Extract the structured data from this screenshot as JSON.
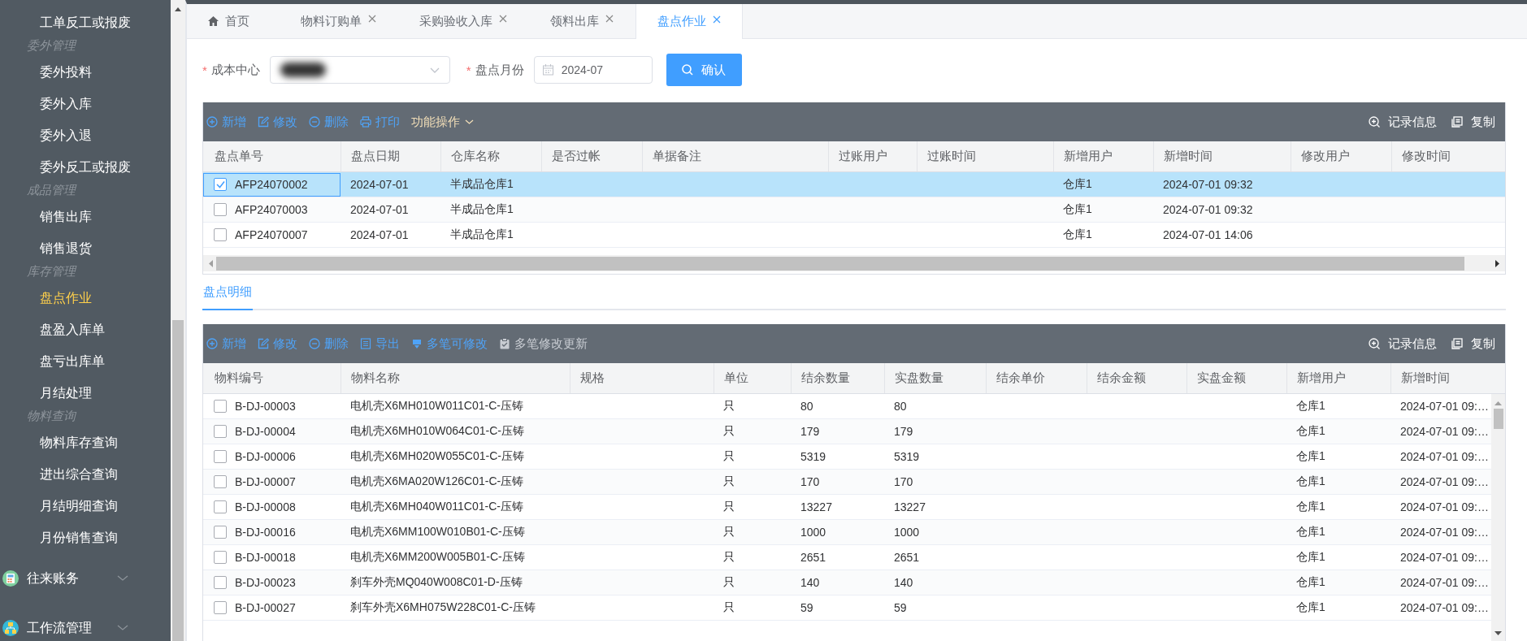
{
  "sidebar": {
    "items": [
      {
        "kind": "item",
        "label": "工单反工或报废",
        "selected": false
      },
      {
        "kind": "group",
        "label": "委外管理"
      },
      {
        "kind": "item",
        "label": "委外投料",
        "selected": false
      },
      {
        "kind": "item",
        "label": "委外入库",
        "selected": false
      },
      {
        "kind": "item",
        "label": "委外入退",
        "selected": false
      },
      {
        "kind": "item",
        "label": "委外反工或报废",
        "selected": false
      },
      {
        "kind": "group",
        "label": "成品管理"
      },
      {
        "kind": "item",
        "label": "销售出库",
        "selected": false
      },
      {
        "kind": "item",
        "label": "销售退货",
        "selected": false
      },
      {
        "kind": "group",
        "label": "库存管理"
      },
      {
        "kind": "item",
        "label": "盘点作业",
        "selected": true
      },
      {
        "kind": "item",
        "label": "盘盈入库单",
        "selected": false
      },
      {
        "kind": "item",
        "label": "盘亏出库单",
        "selected": false
      },
      {
        "kind": "item",
        "label": "月结处理",
        "selected": false
      },
      {
        "kind": "group",
        "label": "物料查询"
      },
      {
        "kind": "item",
        "label": "物料库存查询",
        "selected": false
      },
      {
        "kind": "item",
        "label": "进出综合查询",
        "selected": false
      },
      {
        "kind": "item",
        "label": "月结明细查询",
        "selected": false
      },
      {
        "kind": "item",
        "label": "月份销售查询",
        "selected": false
      },
      {
        "kind": "menu",
        "label": "往来账务"
      },
      {
        "kind": "menu",
        "label": "工作流管理"
      }
    ]
  },
  "tabs": [
    {
      "kind": "home",
      "label": "首页",
      "selected": false
    },
    {
      "kind": "page",
      "label": "物料订购单",
      "selected": false
    },
    {
      "kind": "page",
      "label": "采购验收入库",
      "selected": false
    },
    {
      "kind": "page",
      "label": "领料出库",
      "selected": false
    },
    {
      "kind": "page",
      "label": "盘点作业",
      "selected": true
    }
  ],
  "filter": {
    "fields": [
      {
        "kind": "select",
        "required_mark": "*",
        "label": "成本中心"
      },
      {
        "kind": "date",
        "required_mark": "*",
        "label": "盘点月份",
        "value": "2024-07"
      }
    ],
    "button": "确认"
  },
  "master_grid": {
    "actions": [
      {
        "kind": "add",
        "label": "新增",
        "disabled": false
      },
      {
        "kind": "edit",
        "label": "修改",
        "disabled": false
      },
      {
        "kind": "delete",
        "label": "删除",
        "disabled": false
      },
      {
        "kind": "print",
        "label": "打印",
        "disabled": false
      },
      {
        "kind": "menu",
        "label": "功能操作",
        "disabled": false
      }
    ],
    "right_actions": [
      {
        "kind": "info",
        "label": "记录信息"
      },
      {
        "kind": "copy",
        "label": "复制"
      }
    ],
    "columns": [
      "盘点单号",
      "盘点日期",
      "仓库名称",
      "是否过帐",
      "单据备注",
      "过账用户",
      "过账时间",
      "新增用户",
      "新增时间",
      "修改用户",
      "修改时间"
    ],
    "rows": [
      {
        "selected": true,
        "checked": true,
        "cells": [
          "AFP24070002",
          "2024-07-01",
          "半成品仓库1",
          null,
          null,
          null,
          null,
          "仓库1",
          "2024-07-01 09:32",
          null,
          null
        ]
      },
      {
        "selected": false,
        "checked": false,
        "cells": [
          "AFP24070003",
          "2024-07-01",
          "半成品仓库1",
          null,
          null,
          null,
          null,
          "仓库1",
          "2024-07-01 09:32",
          null,
          null
        ]
      },
      {
        "selected": false,
        "checked": false,
        "cells": [
          "AFP24070007",
          "2024-07-01",
          "半成品仓库1",
          null,
          null,
          null,
          null,
          "仓库1",
          "2024-07-01 14:06",
          null,
          null
        ]
      }
    ]
  },
  "detail_tabs": [
    {
      "label": "盘点明细",
      "selected": true
    }
  ],
  "detail_grid": {
    "actions": [
      {
        "kind": "add",
        "label": "新增",
        "disabled": false
      },
      {
        "kind": "edit",
        "label": "修改",
        "disabled": false
      },
      {
        "kind": "delete",
        "label": "删除",
        "disabled": false
      },
      {
        "kind": "export",
        "label": "导出",
        "disabled": false
      },
      {
        "kind": "multi",
        "label": "多笔可修改",
        "disabled": false
      },
      {
        "kind": "update",
        "label": "多笔修改更新",
        "disabled": true
      }
    ],
    "right_actions": [
      {
        "kind": "info",
        "label": "记录信息"
      },
      {
        "kind": "copy",
        "label": "复制"
      }
    ],
    "columns": [
      "物料编号",
      "物料名称",
      "规格",
      "单位",
      "结余数量",
      "实盘数量",
      "结余单价",
      "结余金额",
      "实盘金额",
      "新增用户",
      "新增时间"
    ],
    "rows": [
      {
        "selected": false,
        "checked": false,
        "cells": [
          "B-DJ-00003",
          "电机壳X6MH010W011C01-C-压铸",
          null,
          "只",
          "80",
          "80",
          null,
          null,
          null,
          "仓库1",
          "2024-07-01 09:…"
        ]
      },
      {
        "selected": false,
        "checked": false,
        "cells": [
          "B-DJ-00004",
          "电机壳X6MH010W064C01-C-压铸",
          null,
          "只",
          "179",
          "179",
          null,
          null,
          null,
          "仓库1",
          "2024-07-01 09:…"
        ]
      },
      {
        "selected": false,
        "checked": false,
        "cells": [
          "B-DJ-00006",
          "电机壳X6MH020W055C01-C-压铸",
          null,
          "只",
          "5319",
          "5319",
          null,
          null,
          null,
          "仓库1",
          "2024-07-01 09:…"
        ]
      },
      {
        "selected": false,
        "checked": false,
        "cells": [
          "B-DJ-00007",
          "电机壳X6MA020W126C01-C-压铸",
          null,
          "只",
          "170",
          "170",
          null,
          null,
          null,
          "仓库1",
          "2024-07-01 09:…"
        ]
      },
      {
        "selected": false,
        "checked": false,
        "cells": [
          "B-DJ-00008",
          "电机壳X6MH040W011C01-C-压铸",
          null,
          "只",
          "13227",
          "13227",
          null,
          null,
          null,
          "仓库1",
          "2024-07-01 09:…"
        ]
      },
      {
        "selected": false,
        "checked": false,
        "cells": [
          "B-DJ-00016",
          "电机壳X6MM100W010B01-C-压铸",
          null,
          "只",
          "1000",
          "1000",
          null,
          null,
          null,
          "仓库1",
          "2024-07-01 09:…"
        ]
      },
      {
        "selected": false,
        "checked": false,
        "cells": [
          "B-DJ-00018",
          "电机壳X6MM200W005B01-C-压铸",
          null,
          "只",
          "2651",
          "2651",
          null,
          null,
          null,
          "仓库1",
          "2024-07-01 09:…"
        ]
      },
      {
        "selected": false,
        "checked": false,
        "cells": [
          "B-DJ-00023",
          "刹车外壳MQ040W008C01-D-压铸",
          null,
          "只",
          "140",
          "140",
          null,
          null,
          null,
          "仓库1",
          "2024-07-01 09:…"
        ]
      },
      {
        "selected": false,
        "checked": false,
        "cells": [
          "B-DJ-00027",
          "刹车外壳X6MH075W228C01-C-压铸",
          null,
          "只",
          "59",
          "59",
          null,
          null,
          null,
          "仓库1",
          "2024-07-01 09:…"
        ]
      }
    ]
  }
}
